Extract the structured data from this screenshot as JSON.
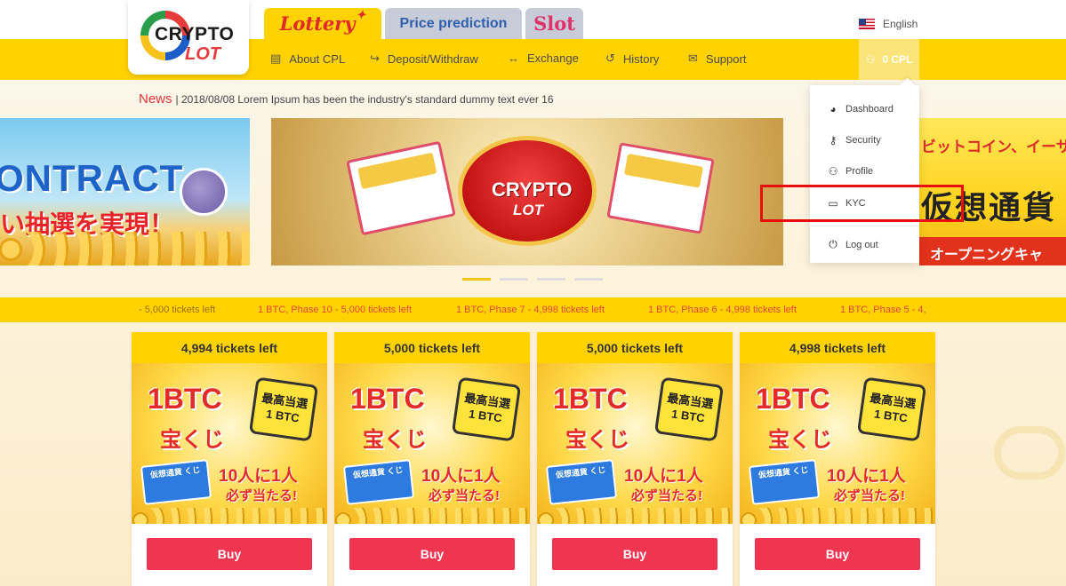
{
  "header": {
    "logo_line1": "CRYPTO",
    "logo_line2": "LOT",
    "tabs": [
      {
        "label": "Lottery",
        "active": true
      },
      {
        "label": "Price prediction",
        "active": false
      },
      {
        "label": "Slot",
        "active": false
      }
    ],
    "language": "English"
  },
  "nav": {
    "items": [
      {
        "label": "About CPL",
        "icon": "info-card-icon"
      },
      {
        "label": "Deposit/Withdraw",
        "icon": "arrow-in-out-icon"
      },
      {
        "label": "Exchange",
        "icon": "exchange-arrows-icon"
      },
      {
        "label": "History",
        "icon": "history-icon"
      },
      {
        "label": "Support",
        "icon": "mail-icon"
      }
    ],
    "account_balance": "0 CPL"
  },
  "news": {
    "label": "News",
    "text": "| 2018/08/08 Lorem Ipsum has been the industry's standard dummy text ever 16"
  },
  "banners": {
    "left_title": "ONTRACT",
    "left_sub": "い抽選を実現！",
    "center_line1": "CRYPTO",
    "center_line2": "LOT",
    "right_line1": "ビットコイン、イーサ",
    "right_line2": "仮想通貨",
    "right_line3": "オープニングキャ"
  },
  "ticker": [
    "- 5,000 tickets left",
    "1 BTC, Phase 10 - 5,000 tickets left",
    "1 BTC, Phase 7 - 4,998 tickets left",
    "1 BTC, Phase 6 - 4,998 tickets left",
    "1 BTC, Phase 5 - 4,"
  ],
  "cards": [
    {
      "header": "4,994 tickets left",
      "buy": "Buy"
    },
    {
      "header": "5,000 tickets left",
      "buy": "Buy"
    },
    {
      "header": "5,000 tickets left",
      "buy": "Buy"
    },
    {
      "header": "4,998 tickets left",
      "buy": "Buy"
    }
  ],
  "card_art": {
    "btc": "1BTC",
    "kuji": "宝くじ",
    "badge_top": "最高当選",
    "badge_bottom": "1 BTC",
    "ticket_text": "仮想通貨 くじ",
    "line1": "10人に1人",
    "line2": "必ず当たる!"
  },
  "dropdown": {
    "items": [
      {
        "label": "Dashboard",
        "icon": "dashboard-icon"
      },
      {
        "label": "Security",
        "icon": "key-icon"
      },
      {
        "label": "Profile",
        "icon": "user-icon"
      },
      {
        "label": "KYC",
        "icon": "id-card-icon"
      },
      {
        "label": "Log out",
        "icon": "power-icon"
      }
    ]
  },
  "colors": {
    "brand_yellow": "#ffd200",
    "buy_red": "#ef3550",
    "news_red": "#e8333a",
    "highlight_red": "#e80e0e"
  }
}
